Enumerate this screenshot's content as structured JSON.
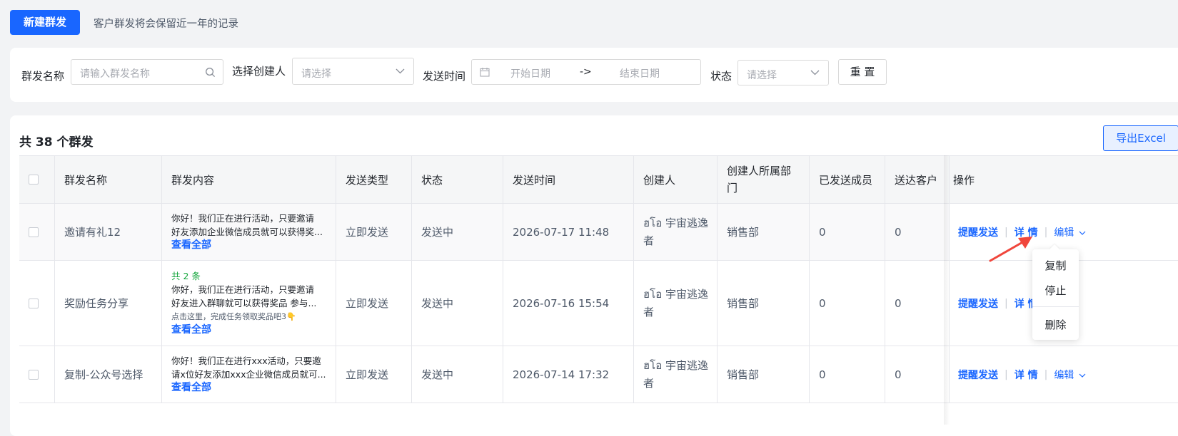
{
  "top": {
    "new_button": "新建群发",
    "note": "客户群发将会保留近一年的记录"
  },
  "filters": {
    "name_label": "群发名称",
    "name_placeholder": "请输入群发名称",
    "creator_label": "选择创建人",
    "creator_placeholder": "请选择",
    "time_label": "发送时间",
    "start_placeholder": "开始日期",
    "range_sep": "->",
    "end_placeholder": "结束日期",
    "status_label": "状态",
    "status_placeholder": "请选择",
    "reset_button": "重 置"
  },
  "list": {
    "total_text": "共 38 个群发",
    "export_button": "导出Excel",
    "columns": [
      "群发名称",
      "群发内容",
      "发送类型",
      "状态",
      "发送时间",
      "创建人",
      "创建人所属部门",
      "已发送成员",
      "送达客户",
      "操作"
    ],
    "view_all": "查看全部",
    "actions": {
      "remind": "提醒发送",
      "detail": "详 情",
      "edit": "编辑"
    },
    "rows": [
      {
        "name": "邀请有礼12",
        "content_line1": "你好！我们正在进行活动，只要邀请",
        "content_line2": "好友添加企业微信成员就可以获得奖...",
        "type": "立即发送",
        "status": "发送中",
        "time": "2026-07-17 11:48",
        "creator_line1": "ฮโอ 宇宙逃逸",
        "creator_line2": "者",
        "dept": "销售部",
        "sent": "0",
        "delivered": "0"
      },
      {
        "name": "奖励任务分享",
        "count": "共 2 条",
        "content_line1": "你好，我们正在进行活动，只要邀请",
        "content_line2": "好友进入群聊就可以获得奖品 参与...",
        "content_line3": "点击这里，完成任务领取奖品吧3👇",
        "type": "立即发送",
        "status": "发送中",
        "time": "2026-07-16 15:54",
        "creator_line1": "ฮโอ 宇宙逃逸",
        "creator_line2": "者",
        "dept": "销售部",
        "sent": "0",
        "delivered": "0"
      },
      {
        "name": "复制-公众号选择",
        "content_line1": "你好！我们正在进行xxx活动，只要邀",
        "content_line2": "请x位好友添加xxx企业微信成员就可...",
        "type": "立即发送",
        "status": "发送中",
        "time": "2026-07-14 17:32",
        "creator_line1": "ฮโอ 宇宙逃逸",
        "creator_line2": "者",
        "dept": "销售部",
        "sent": "0",
        "delivered": "0"
      }
    ]
  },
  "dropdown": {
    "copy": "复制",
    "stop": "停止",
    "delete": "删除"
  },
  "colors": {
    "primary": "#1966ff",
    "count_green": "#14a63c",
    "annotation_red": "#f0463c"
  }
}
